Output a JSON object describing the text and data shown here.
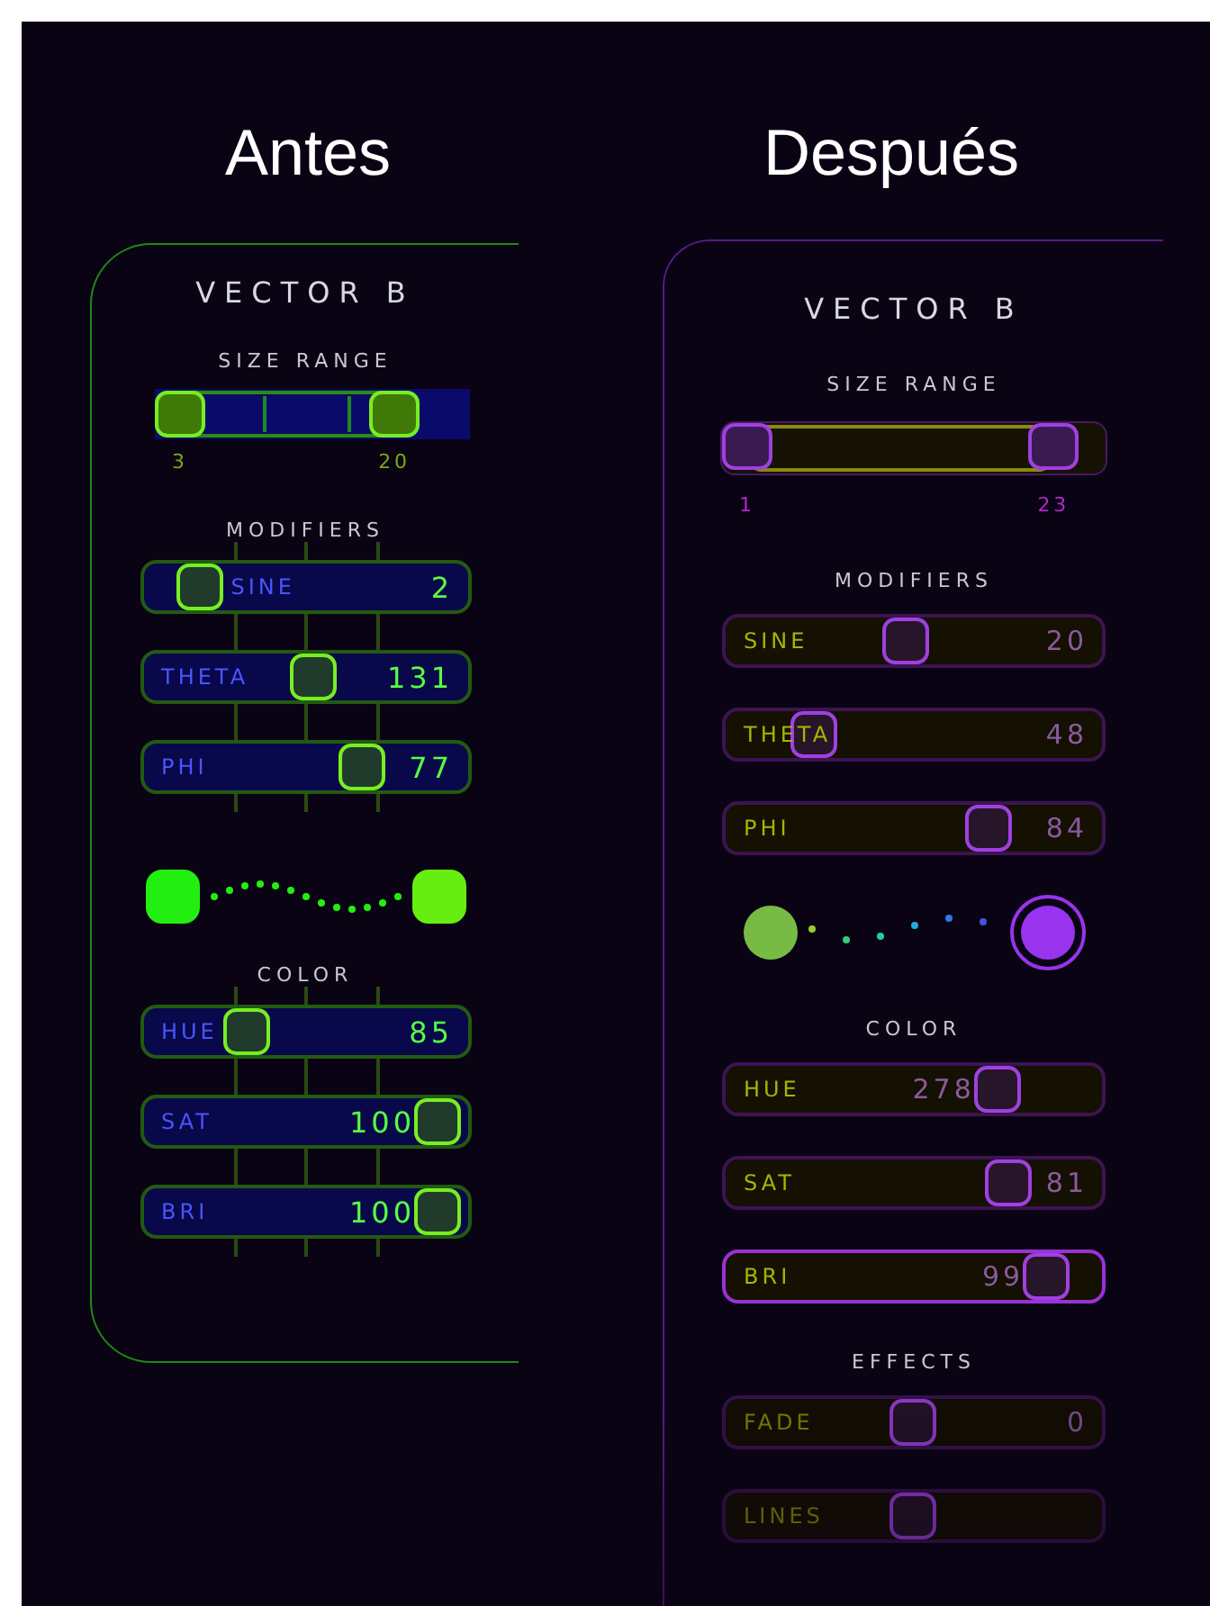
{
  "columns": [
    {
      "heading": "Antes",
      "kind": "classic",
      "panel": {
        "title": "VECTOR B",
        "size_range": {
          "label": "SIZE RANGE",
          "handles": [
            {
              "label": "3",
              "level": 0
            },
            {
              "label": "20",
              "level": 0.81
            }
          ]
        },
        "sections": [
          {
            "kind": "sliders",
            "heading": "MODIFIERS",
            "sliders": [
              {
                "label": "SINE",
                "value": "2",
                "level": 0.11
              },
              {
                "label": "THETA",
                "value": "131",
                "level": 0.54
              },
              {
                "label": "PHI",
                "value": "77",
                "level": 0.72
              }
            ]
          },
          {
            "kind": "preview",
            "swatches": [
              {
                "color": "#22ee11"
              },
              {
                "color": "#66ee11"
              }
            ]
          },
          {
            "kind": "sliders",
            "heading": "COLOR",
            "sliders": [
              {
                "label": "HUE",
                "value": "85",
                "level": 0.29
              },
              {
                "label": "SAT",
                "value": "100",
                "level": 1
              },
              {
                "label": "BRI",
                "value": "100",
                "level": 1
              }
            ]
          }
        ]
      }
    },
    {
      "heading": "Después",
      "kind": "refined",
      "panel": {
        "title": "VECTOR B",
        "size_range": {
          "label": "SIZE RANGE",
          "handles": [
            {
              "label": "1",
              "level": 0
            },
            {
              "label": "23",
              "level": 0.92
            }
          ]
        },
        "sections": [
          {
            "kind": "sliders",
            "heading": "MODIFIERS",
            "sliders": [
              {
                "label": "SINE",
                "value": "20",
                "level": 0.48,
                "selected": false,
                "faded": false
              },
              {
                "label": "THETA",
                "value": "48",
                "level": 0.19,
                "selected": false,
                "faded": false
              },
              {
                "label": "PHI",
                "value": "84",
                "level": 0.74,
                "selected": false,
                "faded": false
              }
            ]
          },
          {
            "kind": "preview",
            "swatches": [
              {
                "color": "#77bb44"
              },
              {
                "color": "#9933ee"
              }
            ]
          },
          {
            "kind": "sliders",
            "heading": "COLOR",
            "sliders": [
              {
                "label": "HUE",
                "value": "278",
                "level": 0.77,
                "selected": false,
                "faded": false
              },
              {
                "label": "SAT",
                "value": "81",
                "level": 0.8,
                "selected": false,
                "faded": false
              },
              {
                "label": "BRI",
                "value": "99",
                "level": 0.92,
                "selected": true,
                "faded": false
              }
            ]
          },
          {
            "kind": "sliders",
            "heading": "EFFECTS",
            "sliders": [
              {
                "label": "FADE",
                "value": "0",
                "level": 0.5,
                "selected": false,
                "faded": true
              },
              {
                "label": "LINES",
                "level": 0.5,
                "selected": false,
                "faded": true
              }
            ]
          }
        ]
      }
    }
  ]
}
